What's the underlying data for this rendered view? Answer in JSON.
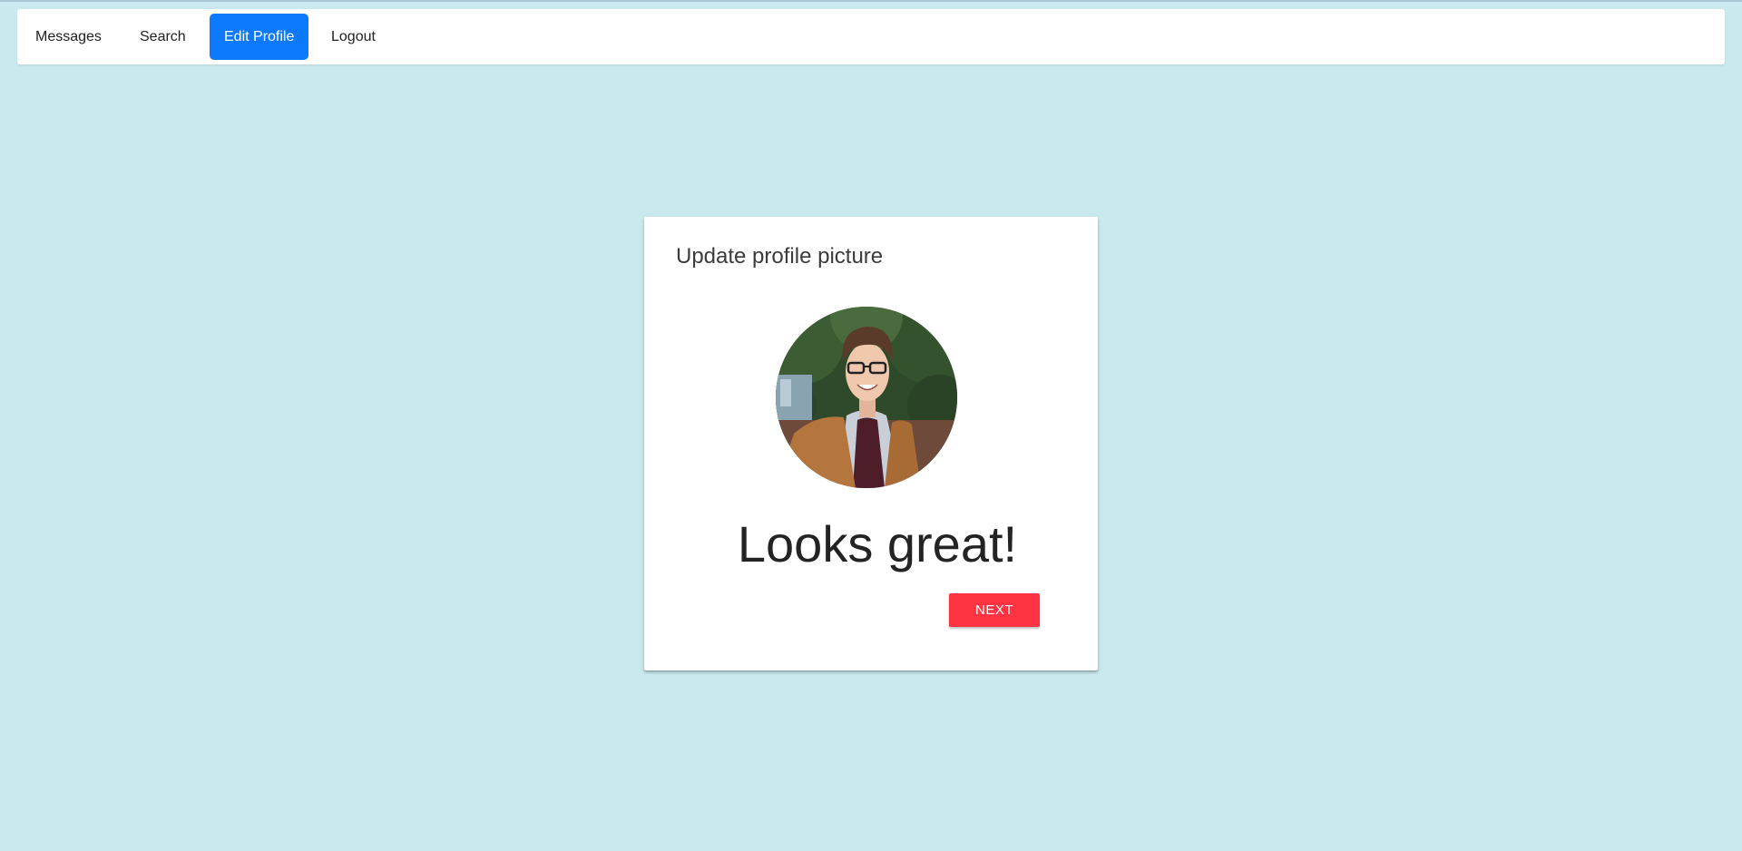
{
  "nav": {
    "items": [
      {
        "label": "Messages",
        "active": false
      },
      {
        "label": "Search",
        "active": false
      },
      {
        "label": "Edit Profile",
        "active": true
      },
      {
        "label": "Logout",
        "active": false
      }
    ]
  },
  "card": {
    "title": "Update profile picture",
    "headline": "Looks great!",
    "next_label": "NEXT"
  },
  "colors": {
    "background": "#c9e9ef",
    "active_nav": "#0d79fd",
    "next_button": "#ff3341"
  }
}
